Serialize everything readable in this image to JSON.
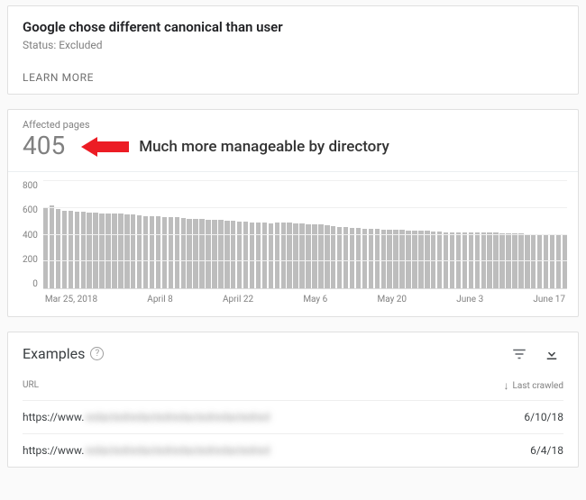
{
  "top_card": {
    "title": "Google chose different canonical than user",
    "status": "Status: Excluded",
    "learn_more": "LEARN MORE"
  },
  "affected": {
    "label": "Affected pages",
    "count": "405"
  },
  "annotation": {
    "text": "Much more manageable by directory"
  },
  "chart_data": {
    "type": "bar",
    "title": "Affected pages",
    "xlabel": "",
    "ylabel": "",
    "ylim": [
      0,
      800
    ],
    "y_ticks": [
      0,
      200,
      400,
      600,
      800
    ],
    "x_ticks": [
      "Mar 25, 2018",
      "April 8",
      "April 22",
      "May 6",
      "May 20",
      "June 3",
      "June 17"
    ],
    "series": [
      {
        "name": "Affected pages",
        "values": [
          600,
          620,
          590,
          580,
          575,
          570,
          570,
          568,
          565,
          560,
          558,
          556,
          555,
          552,
          550,
          545,
          540,
          538,
          535,
          532,
          530,
          528,
          525,
          520,
          518,
          515,
          512,
          510,
          508,
          505,
          502,
          498,
          495,
          492,
          490,
          488,
          487,
          488,
          490,
          488,
          485,
          483,
          480,
          478,
          475,
          470,
          465,
          460,
          455,
          450,
          448,
          446,
          444,
          442,
          440,
          438,
          436,
          434,
          432,
          430,
          430,
          428,
          426,
          424,
          420,
          418,
          418,
          420,
          420,
          420,
          418,
          416,
          414,
          412,
          410,
          408,
          408,
          406,
          406,
          406,
          405,
          405,
          405,
          405
        ]
      }
    ]
  },
  "examples": {
    "title": "Examples",
    "columns": {
      "url": "URL",
      "last_crawled": "Last crawled"
    },
    "url_prefix": "https://www.",
    "rows": [
      {
        "url_hidden": "redactedredactedredactedredactedred",
        "last_crawled": "6/10/18"
      },
      {
        "url_hidden": "redactedredactedredactedredactedred",
        "last_crawled": "6/4/18"
      }
    ]
  }
}
